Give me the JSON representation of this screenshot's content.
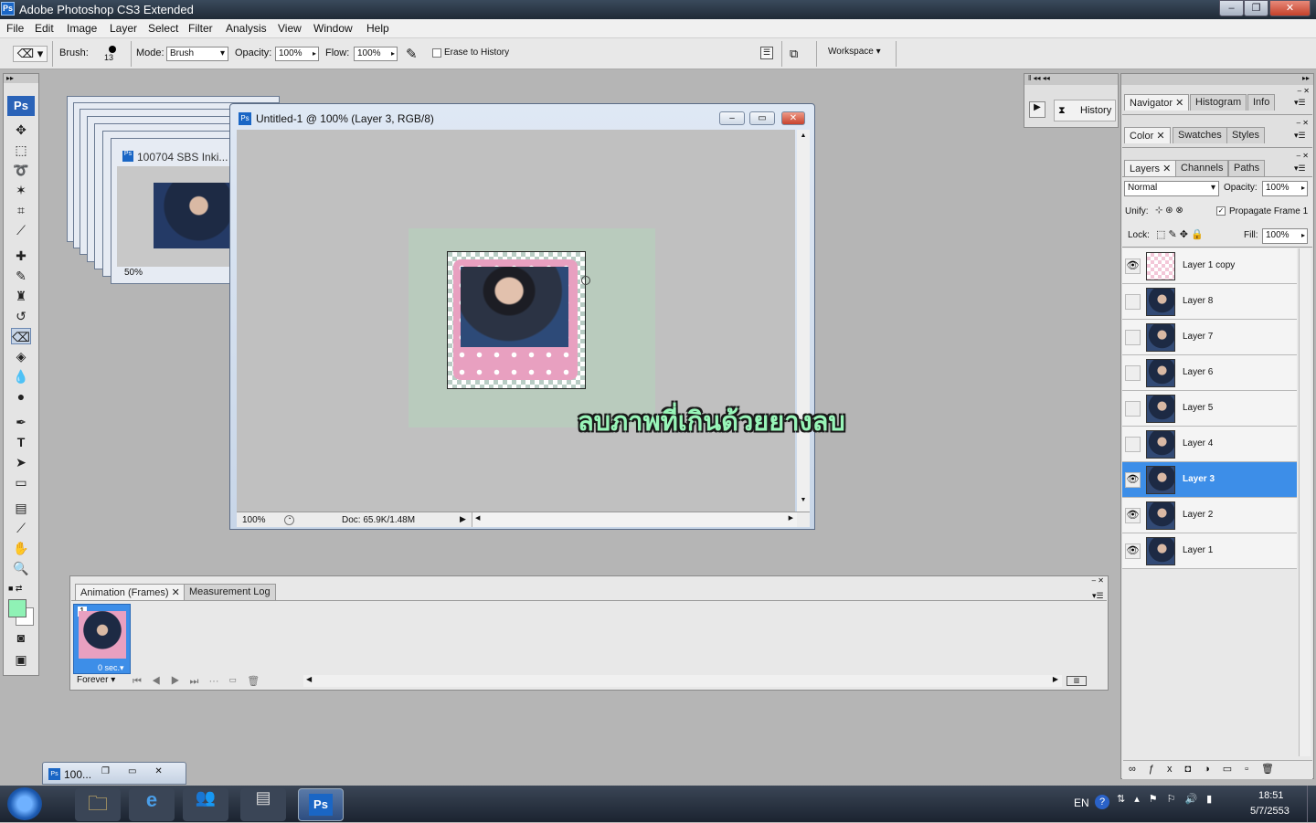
{
  "app": {
    "title": "Adobe Photoshop CS3 Extended",
    "logo": "Ps"
  },
  "menu": [
    "File",
    "Edit",
    "Image",
    "Layer",
    "Select",
    "Filter",
    "Analysis",
    "View",
    "Window",
    "Help"
  ],
  "options": {
    "brush_label": "Brush:",
    "brush_size": "13",
    "mode_label": "Mode:",
    "mode_value": "Brush",
    "opacity_label": "Opacity:",
    "opacity_value": "100%",
    "flow_label": "Flow:",
    "flow_value": "100%",
    "erase_history_label": "Erase to History",
    "workspace_label": "Workspace"
  },
  "back_window": {
    "title": "100704 SBS Inki...",
    "zoom": "50%"
  },
  "main_window": {
    "title": "Untitled-1 @ 100% (Layer 3, RGB/8)",
    "zoom": "100%",
    "doc_info": "Doc: 65.9K/1.48M"
  },
  "overlay_caption": "ลบภาพที่เกินด้วยยางลบ",
  "history_panel": {
    "label": "History"
  },
  "nav_panel": {
    "tabs": [
      "Navigator",
      "Histogram",
      "Info"
    ]
  },
  "color_panel": {
    "tabs": [
      "Color",
      "Swatches",
      "Styles"
    ]
  },
  "layers_panel": {
    "tabs": [
      "Layers",
      "Channels",
      "Paths"
    ],
    "blend_mode": "Normal",
    "opacity_label": "Opacity:",
    "opacity_value": "100%",
    "unify_label": "Unify:",
    "propagate_label": "Propagate Frame 1",
    "lock_label": "Lock:",
    "fill_label": "Fill:",
    "fill_value": "100%",
    "layers": [
      {
        "name": "Layer 1 copy",
        "visible": true,
        "selected": false
      },
      {
        "name": "Layer 8",
        "visible": false,
        "selected": false
      },
      {
        "name": "Layer 7",
        "visible": false,
        "selected": false
      },
      {
        "name": "Layer 6",
        "visible": false,
        "selected": false
      },
      {
        "name": "Layer 5",
        "visible": false,
        "selected": false
      },
      {
        "name": "Layer 4",
        "visible": false,
        "selected": false
      },
      {
        "name": "Layer 3",
        "visible": true,
        "selected": true
      },
      {
        "name": "Layer 2",
        "visible": true,
        "selected": false
      },
      {
        "name": "Layer 1",
        "visible": true,
        "selected": false
      }
    ]
  },
  "animation_panel": {
    "tabs": [
      "Animation (Frames)",
      "Measurement Log"
    ],
    "frame_number": "1",
    "frame_delay": "0 sec.",
    "loop": "Forever"
  },
  "minimized_doc": {
    "title": "100..."
  },
  "taskbar": {
    "lang": "EN",
    "time": "18:51",
    "date": "5/7/2553",
    "ps_label": "Ps"
  },
  "colors": {
    "foreground": "#8ff2b5",
    "background": "#ffffff",
    "selected_layer": "#3d8ee8",
    "caption": "#98f5b8"
  }
}
